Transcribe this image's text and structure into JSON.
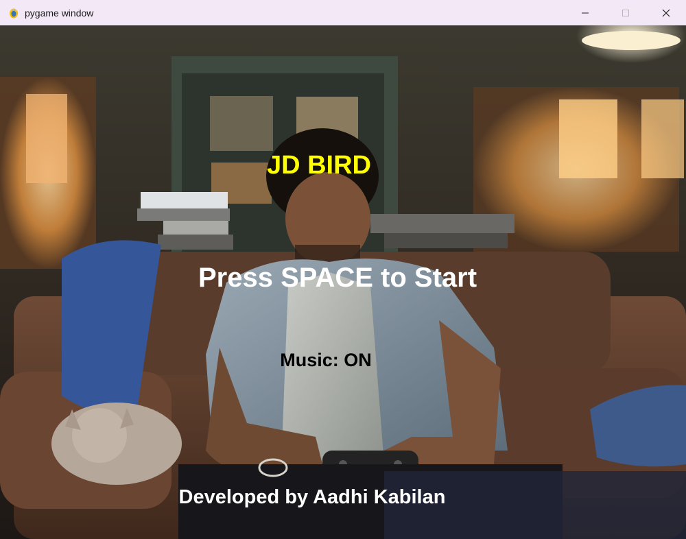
{
  "window": {
    "title": "pygame window",
    "icon": "pygame-snake-icon",
    "controls": [
      "minimize-icon",
      "maximize-icon",
      "close-icon"
    ]
  },
  "game": {
    "title": "JD BIRD",
    "start_prompt": "Press SPACE to Start",
    "music_status": "Music: ON",
    "credits": "Developed by Aadhi Kabilan"
  },
  "colors": {
    "titlebar": "#f3e8f6",
    "game_title": "#ffff00",
    "start_prompt": "#ffffff",
    "music_status": "#000000",
    "credits": "#ffffff"
  }
}
